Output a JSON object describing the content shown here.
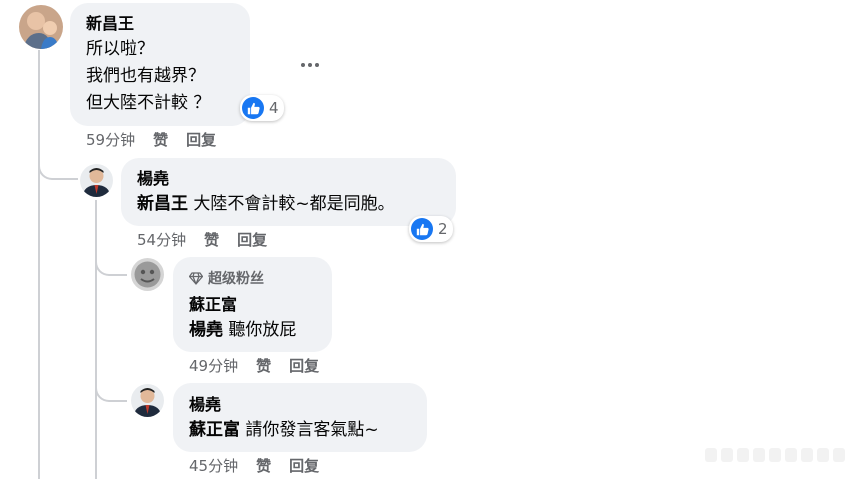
{
  "comments": [
    {
      "author": "新昌王",
      "lines": [
        "所以啦？",
        "我們也有越界？",
        "但大陸不計較 ？"
      ],
      "time": "59分钟",
      "like_label": "赞",
      "reply_label": "回复",
      "reactions": "4"
    },
    {
      "author": "楊堯",
      "mention": "新昌王",
      "text": " 大陸不會計較~都是同胞。",
      "time": "54分钟",
      "like_label": "赞",
      "reply_label": "回复",
      "reactions": "2"
    },
    {
      "badge": "超级粉丝",
      "author": "蘇正富",
      "mention": "楊堯",
      "text": " 聽你放屁",
      "time": "49分钟",
      "like_label": "赞",
      "reply_label": "回复"
    },
    {
      "author": "楊堯",
      "mention": "蘇正富",
      "text": " 請你發言客氣點~",
      "time": "45分钟",
      "like_label": "赞",
      "reply_label": "回复"
    }
  ],
  "colors": {
    "bubble": "#f0f2f5",
    "like_blue": "#1877f2",
    "meta_gray": "#65676b",
    "thread_line": "#ced0d4"
  },
  "icons": [
    "like-icon",
    "more-options-icon",
    "diamond-icon"
  ]
}
